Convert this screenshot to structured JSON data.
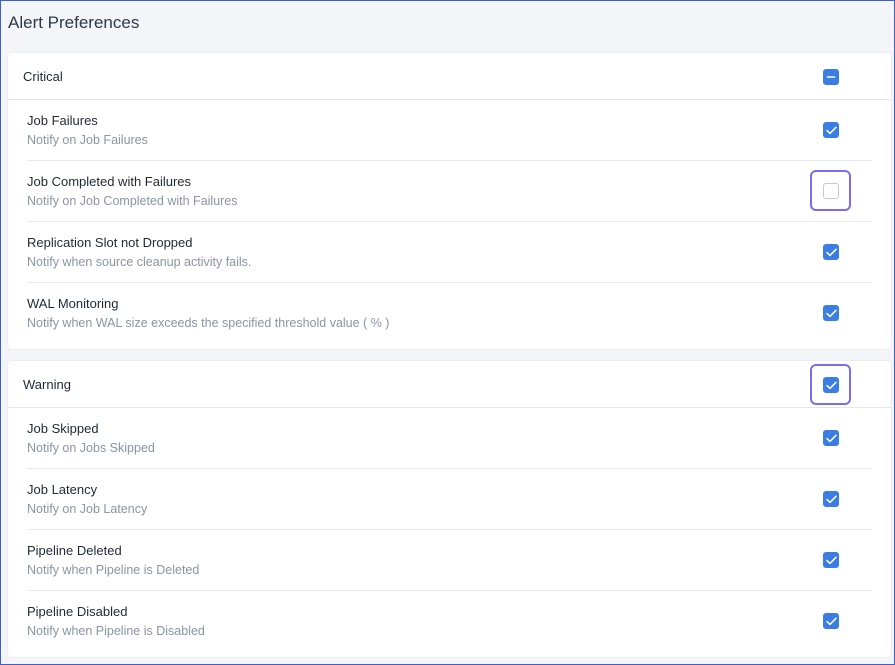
{
  "page": {
    "title": "Alert Preferences"
  },
  "sections": [
    {
      "title": "Critical",
      "state": "indeterminate",
      "focused": false,
      "items": [
        {
          "title": "Job Failures",
          "desc": "Notify on Job Failures",
          "checked": true,
          "focused": false
        },
        {
          "title": "Job Completed with Failures",
          "desc": "Notify on Job Completed with Failures",
          "checked": false,
          "focused": true
        },
        {
          "title": "Replication Slot not Dropped",
          "desc": "Notify when source cleanup activity fails.",
          "checked": true,
          "focused": false
        },
        {
          "title": "WAL Monitoring",
          "desc": "Notify when WAL size exceeds the specified threshold value ( % )",
          "checked": true,
          "focused": false
        }
      ]
    },
    {
      "title": "Warning",
      "state": "checked",
      "focused": true,
      "items": [
        {
          "title": "Job Skipped",
          "desc": "Notify on Jobs Skipped",
          "checked": true,
          "focused": false
        },
        {
          "title": "Job Latency",
          "desc": "Notify on Job Latency",
          "checked": true,
          "focused": false
        },
        {
          "title": "Pipeline Deleted",
          "desc": "Notify when Pipeline is Deleted",
          "checked": true,
          "focused": false
        },
        {
          "title": "Pipeline Disabled",
          "desc": "Notify when Pipeline is Disabled",
          "checked": true,
          "focused": false
        }
      ]
    }
  ],
  "colors": {
    "accent": "#3b7de3",
    "focus": "#7a6cf0",
    "text": "#1f2933",
    "muted": "#8a94a3"
  },
  "icons": {
    "checked": "checkmark-icon",
    "indeterminate": "minus-icon"
  }
}
